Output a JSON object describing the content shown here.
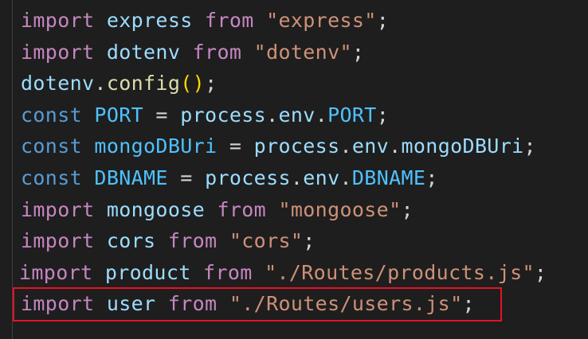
{
  "colors": {
    "background": "#1e1e1e",
    "import_keyword": "#c586c0",
    "declaration_keyword": "#569cd6",
    "variable": "#9cdcfe",
    "constant": "#4fc1ff",
    "function": "#dcdcaa",
    "string": "#ce9178",
    "bracket": "#ffd700",
    "punctuation": "#d4d4d4",
    "highlight_border": "#e81123"
  },
  "code_lines": [
    [
      [
        "import",
        "import"
      ],
      [
        "punct",
        " "
      ],
      [
        "var",
        "express"
      ],
      [
        "punct",
        " "
      ],
      [
        "import",
        "from"
      ],
      [
        "punct",
        " "
      ],
      [
        "string",
        "\"express\""
      ],
      [
        "punct",
        ";"
      ]
    ],
    [
      [
        "import",
        "import"
      ],
      [
        "punct",
        " "
      ],
      [
        "var",
        "dotenv"
      ],
      [
        "punct",
        " "
      ],
      [
        "import",
        "from"
      ],
      [
        "punct",
        " "
      ],
      [
        "string",
        "\"dotenv\""
      ],
      [
        "punct",
        ";"
      ]
    ],
    [
      [
        "var",
        "dotenv"
      ],
      [
        "punct",
        "."
      ],
      [
        "func",
        "config"
      ],
      [
        "paren",
        "()"
      ],
      [
        "punct",
        ";"
      ]
    ],
    [
      [
        "keyword",
        "const"
      ],
      [
        "punct",
        " "
      ],
      [
        "const",
        "PORT"
      ],
      [
        "punct",
        " = "
      ],
      [
        "var",
        "process"
      ],
      [
        "punct",
        "."
      ],
      [
        "var",
        "env"
      ],
      [
        "punct",
        "."
      ],
      [
        "const",
        "PORT"
      ],
      [
        "punct",
        ";"
      ]
    ],
    [
      [
        "keyword",
        "const"
      ],
      [
        "punct",
        " "
      ],
      [
        "const",
        "mongoDBUri"
      ],
      [
        "punct",
        " = "
      ],
      [
        "var",
        "process"
      ],
      [
        "punct",
        "."
      ],
      [
        "var",
        "env"
      ],
      [
        "punct",
        "."
      ],
      [
        "var",
        "mongoDBUri"
      ],
      [
        "punct",
        ";"
      ]
    ],
    [
      [
        "keyword",
        "const"
      ],
      [
        "punct",
        " "
      ],
      [
        "const",
        "DBNAME"
      ],
      [
        "punct",
        " = "
      ],
      [
        "var",
        "process"
      ],
      [
        "punct",
        "."
      ],
      [
        "var",
        "env"
      ],
      [
        "punct",
        "."
      ],
      [
        "const",
        "DBNAME"
      ],
      [
        "punct",
        ";"
      ]
    ],
    [
      [
        "import",
        "import"
      ],
      [
        "punct",
        " "
      ],
      [
        "var",
        "mongoose"
      ],
      [
        "punct",
        " "
      ],
      [
        "import",
        "from"
      ],
      [
        "punct",
        " "
      ],
      [
        "string",
        "\"mongoose\""
      ],
      [
        "punct",
        ";"
      ]
    ],
    [
      [
        "import",
        "import"
      ],
      [
        "punct",
        " "
      ],
      [
        "var",
        "cors"
      ],
      [
        "punct",
        " "
      ],
      [
        "import",
        "from"
      ],
      [
        "punct",
        " "
      ],
      [
        "string",
        "\"cors\""
      ],
      [
        "punct",
        ";"
      ]
    ],
    [
      [
        "import",
        "import"
      ],
      [
        "punct",
        " "
      ],
      [
        "var",
        "product"
      ],
      [
        "punct",
        " "
      ],
      [
        "import",
        "from"
      ],
      [
        "punct",
        " "
      ],
      [
        "string",
        "\"./Routes/products.js\""
      ],
      [
        "punct",
        ";"
      ]
    ],
    [
      [
        "import",
        "import"
      ],
      [
        "punct",
        " "
      ],
      [
        "var",
        "user"
      ],
      [
        "punct",
        " "
      ],
      [
        "import",
        "from"
      ],
      [
        "punct",
        " "
      ],
      [
        "string",
        "\"./Routes/users.js\""
      ],
      [
        "punct",
        ";"
      ]
    ]
  ],
  "highlighted_line": 10
}
